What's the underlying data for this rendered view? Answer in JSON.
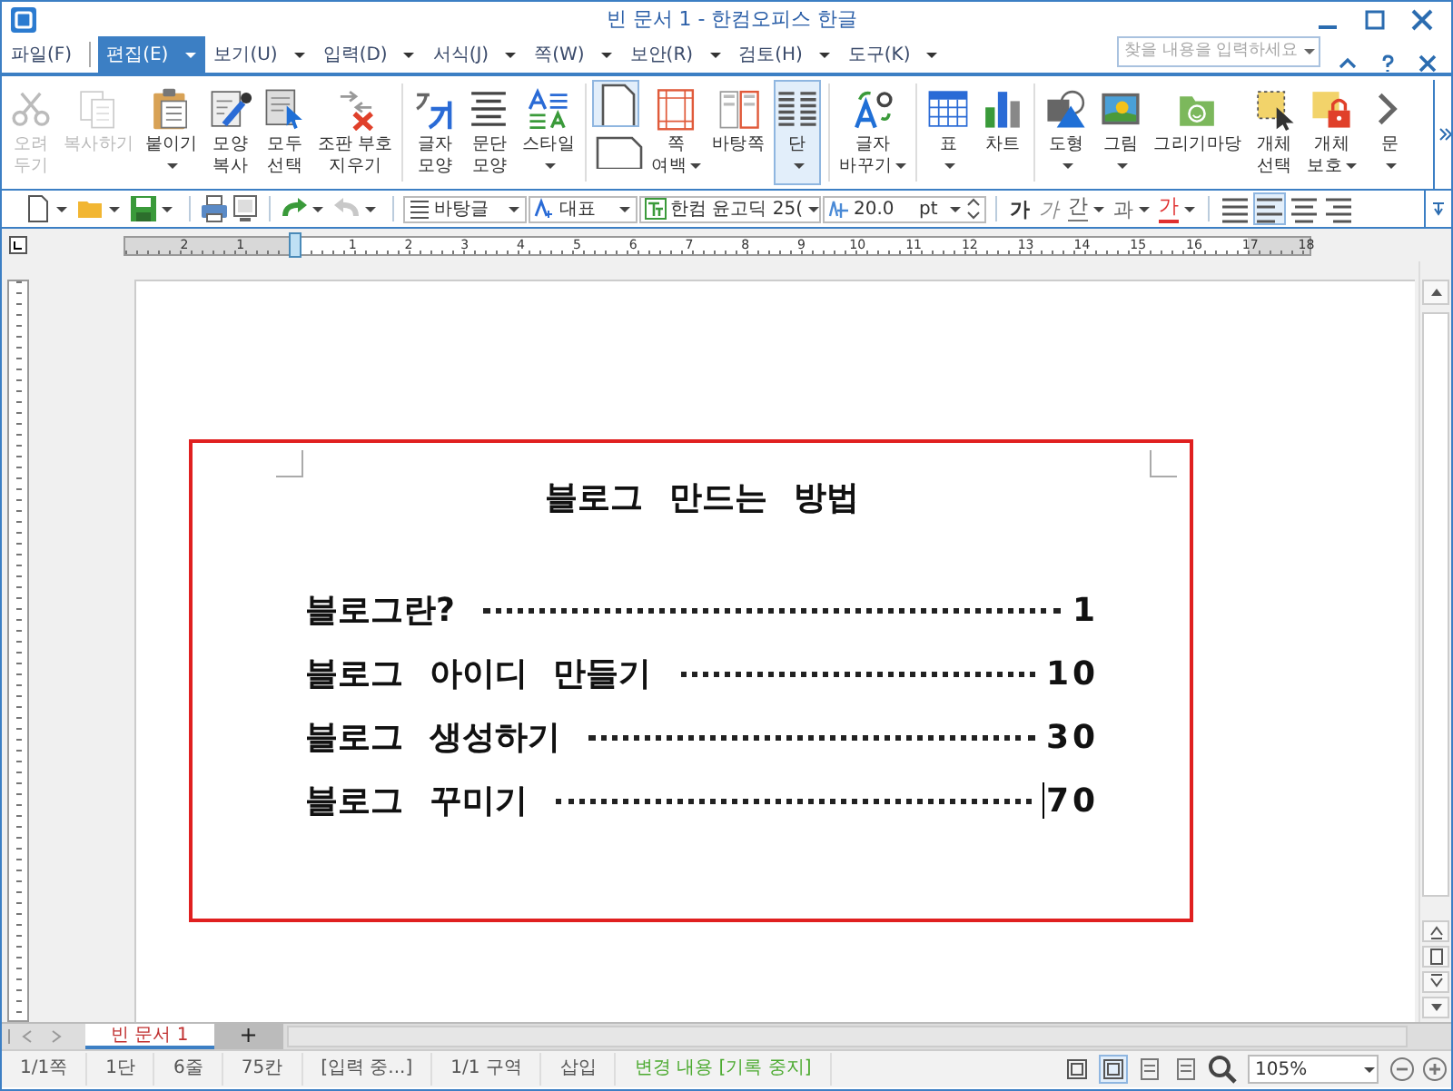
{
  "window": {
    "title": "빈 문서 1 - 한컴오피스 한글"
  },
  "menu": [
    {
      "label": "파일(F)",
      "selected": false,
      "dropdown": false
    },
    {
      "label": "편집(E)",
      "selected": true,
      "dropdown": true
    },
    {
      "label": "보기(U)",
      "selected": false,
      "dropdown": true
    },
    {
      "label": "입력(D)",
      "selected": false,
      "dropdown": true
    },
    {
      "label": "서식(J)",
      "selected": false,
      "dropdown": true
    },
    {
      "label": "쪽(W)",
      "selected": false,
      "dropdown": true
    },
    {
      "label": "보안(R)",
      "selected": false,
      "dropdown": true
    },
    {
      "label": "검토(H)",
      "selected": false,
      "dropdown": true
    },
    {
      "label": "도구(K)",
      "selected": false,
      "dropdown": true
    }
  ],
  "search": {
    "placeholder": "찾을 내용을 입력하세요."
  },
  "ribbon": {
    "groups": [
      [
        {
          "kind": "button",
          "lines": [
            "오려",
            "두기"
          ],
          "disabled": true,
          "selected": false,
          "dropdown": false
        },
        {
          "kind": "button",
          "lines": [
            "복사하기"
          ],
          "disabled": true,
          "selected": false,
          "dropdown": false
        },
        {
          "kind": "button",
          "lines": [
            "붙이기"
          ],
          "disabled": false,
          "selected": false,
          "dropdown": true
        },
        {
          "kind": "button",
          "lines": [
            "모양",
            "복사"
          ],
          "disabled": false,
          "selected": false,
          "dropdown": false
        },
        {
          "kind": "button",
          "lines": [
            "모두",
            "선택"
          ],
          "disabled": false,
          "selected": false,
          "dropdown": false
        },
        {
          "kind": "button",
          "lines": [
            "조판 부호",
            "지우기"
          ],
          "disabled": false,
          "selected": false,
          "dropdown": false
        }
      ],
      [
        {
          "kind": "button",
          "lines": [
            "글자",
            "모양"
          ],
          "disabled": false,
          "selected": false,
          "dropdown": false
        },
        {
          "kind": "button",
          "lines": [
            "문단",
            "모양"
          ],
          "disabled": false,
          "selected": false,
          "dropdown": false
        },
        {
          "kind": "button",
          "lines": [
            "스타일"
          ],
          "disabled": false,
          "selected": false,
          "dropdown": true
        }
      ],
      [
        {
          "kind": "pages",
          "selected": true
        },
        {
          "kind": "button",
          "lines": [
            "쪽",
            "여백"
          ],
          "disabled": false,
          "selected": false,
          "dropdown": true
        },
        {
          "kind": "button",
          "lines": [
            "바탕쪽"
          ],
          "disabled": false,
          "selected": false,
          "dropdown": false
        },
        {
          "kind": "button",
          "lines": [
            "단"
          ],
          "disabled": false,
          "selected": true,
          "dropdown": true
        }
      ],
      [
        {
          "kind": "button",
          "lines": [
            "글자",
            "바꾸기"
          ],
          "disabled": false,
          "selected": false,
          "dropdown": true
        }
      ],
      [
        {
          "kind": "button",
          "lines": [
            "표"
          ],
          "disabled": false,
          "selected": false,
          "dropdown": true
        },
        {
          "kind": "button",
          "lines": [
            "차트"
          ],
          "disabled": false,
          "selected": false,
          "dropdown": false
        }
      ],
      [
        {
          "kind": "button",
          "lines": [
            "도형"
          ],
          "disabled": false,
          "selected": false,
          "dropdown": true
        },
        {
          "kind": "button",
          "lines": [
            "그림"
          ],
          "disabled": false,
          "selected": false,
          "dropdown": true
        },
        {
          "kind": "button",
          "lines": [
            "그리기마당"
          ],
          "disabled": false,
          "selected": false,
          "dropdown": false
        },
        {
          "kind": "button",
          "lines": [
            "개체",
            "선택"
          ],
          "disabled": false,
          "selected": false,
          "dropdown": false
        },
        {
          "kind": "button",
          "lines": [
            "개체",
            "보호"
          ],
          "disabled": false,
          "selected": false,
          "dropdown": true
        },
        {
          "kind": "button",
          "lines": [
            "문"
          ],
          "disabled": false,
          "selected": false,
          "dropdown": true
        }
      ]
    ]
  },
  "toolbar": {
    "style": "바탕글",
    "language": "대표",
    "font": "한컴 윤고딕 25(",
    "size": "20.0",
    "unit": "pt",
    "format_buttons": [
      {
        "kind": "bold",
        "label": "가",
        "dropdown": false
      },
      {
        "kind": "italic",
        "label": "가",
        "dropdown": false
      },
      {
        "kind": "underline",
        "label": "간",
        "dropdown": true
      },
      {
        "kind": "strike",
        "label": "과",
        "dropdown": true
      },
      {
        "kind": "color",
        "label": "가",
        "dropdown": true
      }
    ],
    "align_buttons": [
      {
        "selected": false
      },
      {
        "selected": true
      },
      {
        "selected": false
      },
      {
        "selected": false
      }
    ]
  },
  "ruler": {
    "labels": [
      "2",
      "1",
      "1",
      "2",
      "3",
      "4",
      "5",
      "6",
      "7",
      "8",
      "9",
      "10",
      "11",
      "12",
      "13",
      "14",
      "15",
      "16",
      "17",
      "18"
    ]
  },
  "document": {
    "title": "블로그 만드는 방법",
    "toc": [
      {
        "text": "블로그란?",
        "page": "1",
        "cursor": false
      },
      {
        "text": "블로그 아이디 만들기",
        "page": "10",
        "cursor": false
      },
      {
        "text": "블로그 생성하기",
        "page": "30",
        "cursor": false
      },
      {
        "text": "블로그 꾸미기",
        "page": "70",
        "cursor": true
      }
    ]
  },
  "tabs": [
    {
      "label": "빈 문서 1",
      "selected": true
    }
  ],
  "new_tab": "+",
  "status_bar": {
    "items": [
      "1/1쪽",
      "1단",
      "6줄",
      "75칸",
      "[입력 중...]",
      "1/1 구역",
      "삽입"
    ],
    "change_log": "변경 내용 [기록 중지]",
    "zoom": "105%"
  }
}
